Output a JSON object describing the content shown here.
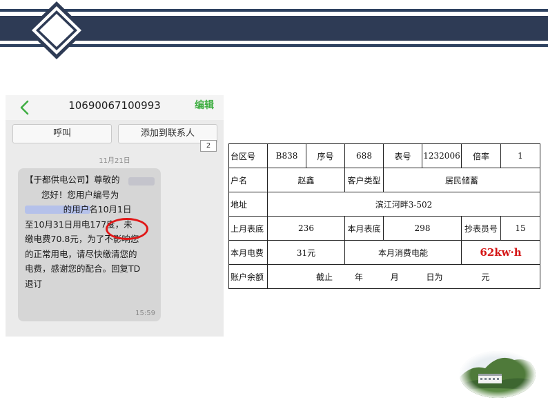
{
  "phone": {
    "sender_number": "10690067100993",
    "edit_label": "编辑",
    "call_label": "呼叫",
    "add_contact_label": "添加到联系人",
    "badge": "2",
    "date": "11月21日",
    "message": {
      "line1": "【于都供电公司】尊敬的",
      "line2": "您好！您用户编号为",
      "line3": "的用户名10月1日",
      "line4": "至10月31日用电",
      "line4_usage": "177度，",
      "line4_end": "未",
      "line5": "缴电费70.8元，为了不影响您",
      "line6": "的正常用电，请尽快缴清您的",
      "line7": "电费，感谢您的配合。回复TD",
      "line8": "退订"
    },
    "time": "15:59"
  },
  "bill": {
    "area_label": "台区号",
    "area_value": "B838",
    "seq_label": "序号",
    "seq_value": "688",
    "meter_label": "表号",
    "meter_value": "1232006",
    "ratio_label": "倍率",
    "ratio_value": "1",
    "name_label": "户名",
    "name_value": "赵鑫",
    "type_label": "客户类型",
    "type_value": "居民储蓄",
    "addr_label": "地址",
    "addr_value": "滨江河畔3-502",
    "prev_label": "上月表底",
    "prev_value": "236",
    "curr_label": "本月表底",
    "curr_value": "298",
    "reader_label": "抄表员号",
    "reader_value": "15",
    "fee_label": "本月电费",
    "fee_value": "31元",
    "energy_label": "本月消费电能",
    "energy_value": "62kw·h",
    "balance_label": "账户余额",
    "balance_parts": {
      "p1": "截止",
      "p2": "年",
      "p3": "月",
      "p4": "日为",
      "p5": "元"
    }
  },
  "colors": {
    "header_navy": "#2e3b55",
    "accent_green": "#3fae42",
    "highlight_red": "#e01818"
  }
}
